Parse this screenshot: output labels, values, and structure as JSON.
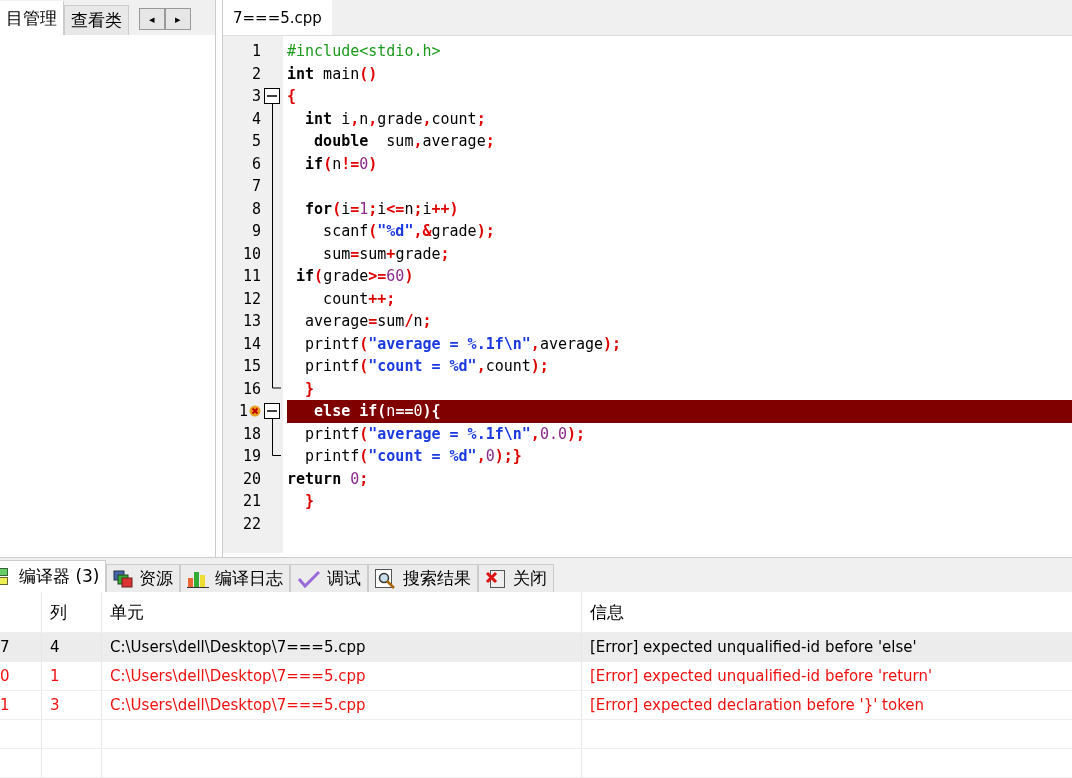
{
  "left_panel": {
    "tabs": [
      {
        "label": "目管理",
        "selected": true
      },
      {
        "label": "查看类",
        "selected": false
      }
    ],
    "scroll_buttons": [
      "◂",
      "▸"
    ]
  },
  "editor": {
    "tabs": [
      {
        "label": "7===5.cpp",
        "selected": true
      }
    ],
    "lines": [
      {
        "number": "1",
        "tokens": [
          {
            "kind": "pre",
            "text": "#include<stdio.h>"
          }
        ]
      },
      {
        "number": "2",
        "tokens": [
          {
            "kind": "kw",
            "text": "int"
          },
          {
            "kind": "id",
            "text": " main"
          },
          {
            "kind": "punct",
            "text": "()"
          }
        ]
      },
      {
        "number": "3",
        "fold_start": true,
        "tokens": [
          {
            "kind": "punct",
            "text": "{"
          }
        ]
      },
      {
        "number": "4",
        "tokens": [
          {
            "kind": "kw",
            "text": "  int"
          },
          {
            "kind": "id",
            "text": " i"
          },
          {
            "kind": "punct",
            "text": ","
          },
          {
            "kind": "id",
            "text": "n"
          },
          {
            "kind": "punct",
            "text": ","
          },
          {
            "kind": "id",
            "text": "grade"
          },
          {
            "kind": "punct",
            "text": ","
          },
          {
            "kind": "id",
            "text": "count"
          },
          {
            "kind": "punct",
            "text": ";"
          }
        ]
      },
      {
        "number": "5",
        "tokens": [
          {
            "kind": "kw",
            "text": "   double"
          },
          {
            "kind": "id",
            "text": "  sum"
          },
          {
            "kind": "punct",
            "text": ","
          },
          {
            "kind": "id",
            "text": "average"
          },
          {
            "kind": "punct",
            "text": ";"
          }
        ]
      },
      {
        "number": "6",
        "tokens": [
          {
            "kind": "kw",
            "text": "  if"
          },
          {
            "kind": "punct",
            "text": "("
          },
          {
            "kind": "id",
            "text": "n"
          },
          {
            "kind": "punct",
            "text": "!="
          },
          {
            "kind": "num",
            "text": "0"
          },
          {
            "kind": "punct",
            "text": ")"
          }
        ]
      },
      {
        "number": "7"
      },
      {
        "number": "8",
        "tokens": [
          {
            "kind": "kw",
            "text": "  for"
          },
          {
            "kind": "punct",
            "text": "("
          },
          {
            "kind": "id",
            "text": "i"
          },
          {
            "kind": "punct",
            "text": "="
          },
          {
            "kind": "num",
            "text": "1"
          },
          {
            "kind": "punct",
            "text": ";"
          },
          {
            "kind": "id",
            "text": "i"
          },
          {
            "kind": "punct",
            "text": "<="
          },
          {
            "kind": "id",
            "text": "n"
          },
          {
            "kind": "punct",
            "text": ";"
          },
          {
            "kind": "id",
            "text": "i"
          },
          {
            "kind": "punct",
            "text": "++)"
          }
        ]
      },
      {
        "number": "9",
        "tokens": [
          {
            "kind": "id",
            "text": "    scanf"
          },
          {
            "kind": "punct",
            "text": "("
          },
          {
            "kind": "str",
            "text": "\"%d\""
          },
          {
            "kind": "punct",
            "text": ",&"
          },
          {
            "kind": "id",
            "text": "grade"
          },
          {
            "kind": "punct",
            "text": ");"
          }
        ]
      },
      {
        "number": "10",
        "tokens": [
          {
            "kind": "id",
            "text": "    sum"
          },
          {
            "kind": "punct",
            "text": "="
          },
          {
            "kind": "id",
            "text": "sum"
          },
          {
            "kind": "punct",
            "text": "+"
          },
          {
            "kind": "id",
            "text": "grade"
          },
          {
            "kind": "punct",
            "text": ";"
          }
        ]
      },
      {
        "number": "11",
        "tokens": [
          {
            "kind": "kw",
            "text": " if"
          },
          {
            "kind": "punct",
            "text": "("
          },
          {
            "kind": "id",
            "text": "grade"
          },
          {
            "kind": "punct",
            "text": ">="
          },
          {
            "kind": "num",
            "text": "60"
          },
          {
            "kind": "punct",
            "text": ")"
          }
        ]
      },
      {
        "number": "12",
        "tokens": [
          {
            "kind": "id",
            "text": "    count"
          },
          {
            "kind": "punct",
            "text": "++;"
          }
        ]
      },
      {
        "number": "13",
        "tokens": [
          {
            "kind": "id",
            "text": "  average"
          },
          {
            "kind": "punct",
            "text": "="
          },
          {
            "kind": "id",
            "text": "sum"
          },
          {
            "kind": "punct",
            "text": "/"
          },
          {
            "kind": "id",
            "text": "n"
          },
          {
            "kind": "punct",
            "text": ";"
          }
        ]
      },
      {
        "number": "14",
        "tokens": [
          {
            "kind": "id",
            "text": "  printf"
          },
          {
            "kind": "punct",
            "text": "("
          },
          {
            "kind": "str",
            "text": "\"average = %.1f\\n\""
          },
          {
            "kind": "punct",
            "text": ","
          },
          {
            "kind": "id",
            "text": "average"
          },
          {
            "kind": "punct",
            "text": ");"
          }
        ]
      },
      {
        "number": "15",
        "tokens": [
          {
            "kind": "id",
            "text": "  printf"
          },
          {
            "kind": "punct",
            "text": "("
          },
          {
            "kind": "str",
            "text": "\"count = %d\""
          },
          {
            "kind": "punct",
            "text": ","
          },
          {
            "kind": "id",
            "text": "count"
          },
          {
            "kind": "punct",
            "text": ");"
          }
        ]
      },
      {
        "number": "16",
        "fold_end": true,
        "tokens": [
          {
            "kind": "punct",
            "text": "  }"
          }
        ]
      },
      {
        "number": "1",
        "fold_start": true,
        "error": true,
        "tokens": [
          {
            "kind": "kw",
            "text": "   else if"
          },
          {
            "kind": "punct",
            "text": "("
          },
          {
            "kind": "id",
            "text": "n"
          },
          {
            "kind": "punct",
            "text": "=="
          },
          {
            "kind": "num",
            "text": "0"
          },
          {
            "kind": "punct",
            "text": "){"
          }
        ]
      },
      {
        "number": "18",
        "tokens": [
          {
            "kind": "id",
            "text": "  printf"
          },
          {
            "kind": "punct",
            "text": "("
          },
          {
            "kind": "str",
            "text": "\"average = %.1f\\n\""
          },
          {
            "kind": "punct",
            "text": ","
          },
          {
            "kind": "num",
            "text": "0.0"
          },
          {
            "kind": "punct",
            "text": ");"
          }
        ]
      },
      {
        "number": "19",
        "fold_end": true,
        "tokens": [
          {
            "kind": "id",
            "text": "  printf"
          },
          {
            "kind": "punct",
            "text": "("
          },
          {
            "kind": "str",
            "text": "\"count = %d\""
          },
          {
            "kind": "punct",
            "text": ","
          },
          {
            "kind": "num",
            "text": "0"
          },
          {
            "kind": "punct",
            "text": ");}"
          }
        ]
      },
      {
        "number": "20",
        "tokens": [
          {
            "kind": "kw",
            "text": "return"
          },
          {
            "kind": "num",
            "text": " 0"
          },
          {
            "kind": "punct",
            "text": ";"
          }
        ]
      },
      {
        "number": "21",
        "tokens": [
          {
            "kind": "punct",
            "text": "  }"
          }
        ]
      },
      {
        "number": "22"
      }
    ]
  },
  "bottom_tabs": [
    {
      "kind": "grid",
      "label": "编译器 (3)",
      "selected": true
    },
    {
      "kind": "resources",
      "label": "资源",
      "selected": false
    },
    {
      "kind": "chart",
      "label": "编译日志",
      "selected": false
    },
    {
      "kind": "check",
      "label": "调试",
      "selected": false
    },
    {
      "kind": "search",
      "label": "搜索结果",
      "selected": false
    },
    {
      "kind": "close",
      "label": "关闭",
      "selected": false
    }
  ],
  "messages": {
    "columns": [
      "列",
      "单元",
      "信息"
    ],
    "rows": [
      {
        "line": "7",
        "column": "4",
        "unit": "C:\\Users\\dell\\Desktop\\7===5.cpp",
        "message": "[Error] expected unqualified-id before 'else'",
        "selected": true
      },
      {
        "line": "0",
        "column": "1",
        "unit": "C:\\Users\\dell\\Desktop\\7===5.cpp",
        "message": "[Error] expected unqualified-id before 'return'",
        "selected": false
      },
      {
        "line": "1",
        "column": "3",
        "unit": "C:\\Users\\dell\\Desktop\\7===5.cpp",
        "message": "[Error] expected declaration before '}' token",
        "selected": false
      }
    ]
  }
}
